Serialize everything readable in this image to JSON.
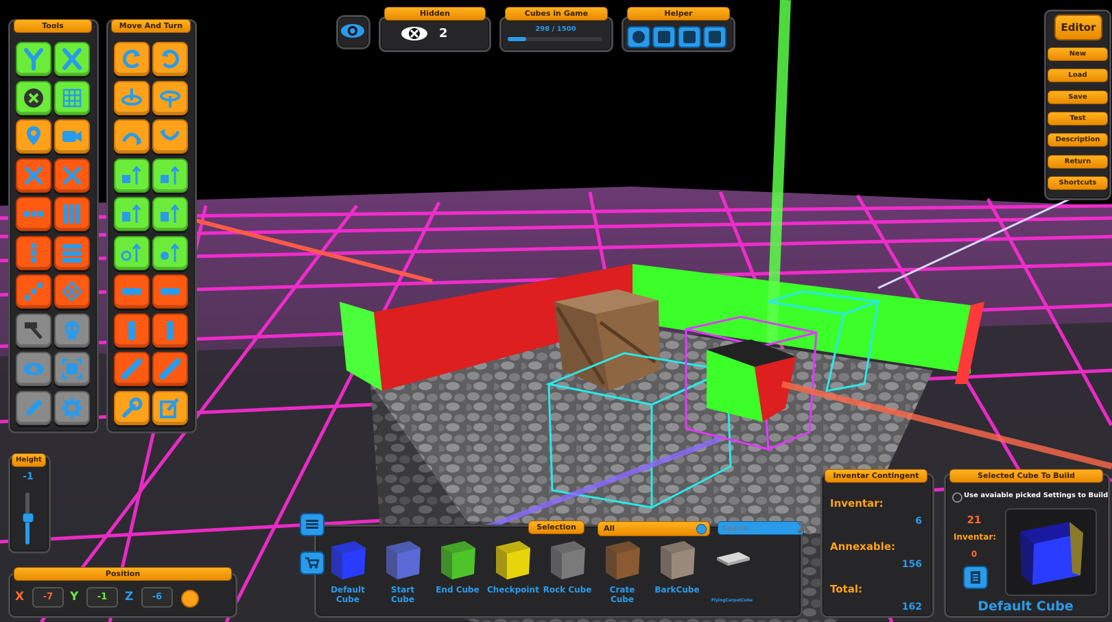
{
  "tools_panel": {
    "title": "Tools",
    "tools": [
      {
        "icon": "y-axis-icon",
        "color": "green"
      },
      {
        "icon": "x-axis-icon",
        "color": "green"
      },
      {
        "icon": "circle-x-icon",
        "color": "green"
      },
      {
        "icon": "grid-icon",
        "color": "green"
      },
      {
        "icon": "map-pin-icon",
        "color": "orange"
      },
      {
        "icon": "camera-icon",
        "color": "orange"
      },
      {
        "icon": "collapse-icon",
        "color": "red"
      },
      {
        "icon": "expand-icon",
        "color": "red"
      },
      {
        "icon": "row-dots-icon",
        "color": "red"
      },
      {
        "icon": "column-dots-icon",
        "color": "red"
      },
      {
        "icon": "vertical-dots-icon",
        "color": "red"
      },
      {
        "icon": "list-icon",
        "color": "red"
      },
      {
        "icon": "diagonal-dots-icon",
        "color": "red"
      },
      {
        "icon": "diagonal-grid-icon",
        "color": "red"
      },
      {
        "icon": "hammer-icon",
        "color": "gray"
      },
      {
        "icon": "skull-icon",
        "color": "gray"
      },
      {
        "icon": "hidden-eye-icon",
        "color": "gray"
      },
      {
        "icon": "frame-icon",
        "color": "gray"
      },
      {
        "icon": "pencil-icon",
        "color": "gray"
      },
      {
        "icon": "gear-icon",
        "color": "gray"
      }
    ]
  },
  "move_panel": {
    "title": "Move And Turn",
    "tools": [
      {
        "icon": "rotate-left-icon",
        "color": "orange"
      },
      {
        "icon": "rotate-right-icon",
        "color": "orange"
      },
      {
        "icon": "turn-down-icon",
        "color": "orange"
      },
      {
        "icon": "turn-up-icon",
        "color": "orange"
      },
      {
        "icon": "flip-left-icon",
        "color": "orange"
      },
      {
        "icon": "flip-right-icon",
        "color": "orange"
      },
      {
        "icon": "move-up-triangle-icon",
        "color": "green"
      },
      {
        "icon": "move-up-square-icon",
        "color": "green"
      },
      {
        "icon": "move-left-icon",
        "color": "green"
      },
      {
        "icon": "move-right-icon",
        "color": "green"
      },
      {
        "icon": "move-circle-icon",
        "color": "green"
      },
      {
        "icon": "move-target-icon",
        "color": "green"
      },
      {
        "icon": "bar-horizontal-icon",
        "color": "red"
      },
      {
        "icon": "bar-horizontal-icon",
        "color": "red"
      },
      {
        "icon": "bar-vertical-icon",
        "color": "red"
      },
      {
        "icon": "bar-vertical-icon",
        "color": "red"
      },
      {
        "icon": "bar-diagonal-icon",
        "color": "red"
      },
      {
        "icon": "bar-diagonal-icon",
        "color": "red"
      },
      {
        "icon": "wrench-icon",
        "color": "orange"
      },
      {
        "icon": "edit-icon",
        "color": "orange"
      }
    ]
  },
  "height_panel": {
    "title": "Height",
    "value": "-1",
    "slider_fraction": 0.5
  },
  "position_panel": {
    "title": "Position",
    "x_label": "X",
    "x": "-7",
    "y_label": "Y",
    "y": "-1",
    "z_label": "Z",
    "z": "-6"
  },
  "top_bar": {
    "hidden": {
      "title": "Hidden",
      "count": "2"
    },
    "cubes_in_game": {
      "title": "Cubes in Game",
      "text": "298 / 1500",
      "fraction": 0.199
    },
    "helper": {
      "title": "Helper",
      "icons": [
        "center-icon",
        "up-arrow-icon",
        "frame-select-icon",
        "eraser-icon"
      ]
    }
  },
  "editor_menu": {
    "title": "Editor",
    "items": [
      "New",
      "Load",
      "Save",
      "Test",
      "Description",
      "Return",
      "Shortcuts"
    ]
  },
  "selection_bar": {
    "title": "Selection",
    "filter": "All",
    "search_placeholder": "Search...",
    "cubes": [
      {
        "name_line1": "Default",
        "name_line2": "Cube",
        "color": "#2a3cff"
      },
      {
        "name_line1": "Start",
        "name_line2": "Cube",
        "color": "#5a6ad6"
      },
      {
        "name_line1": "End Cube",
        "name_line2": "",
        "color": "#4ec42a"
      },
      {
        "name_line1": "Checkpoint",
        "name_line2": "",
        "color": "#e8d40a"
      },
      {
        "name_line1": "Rock Cube",
        "name_line2": "",
        "color": "#7a7a7a"
      },
      {
        "name_line1": "Crate",
        "name_line2": "Cube",
        "color": "#8a5a32"
      },
      {
        "name_line1": "BarkCube",
        "name_line2": "",
        "color": "#9a8a7a"
      },
      {
        "name_line1": "FlyingCarpetCube",
        "name_line2": "",
        "color": "#d8d8d8"
      }
    ]
  },
  "inventar_contingent": {
    "title": "Inventar Contingent",
    "inventar_label": "Inventar:",
    "inventar": "6",
    "annexable_label": "Annexable:",
    "annexable": "156",
    "total_label": "Total:",
    "total": "162"
  },
  "selected_cube": {
    "title": "Selected Cube To Build",
    "option": "Use avaiable picked Settings to Build",
    "count": "21",
    "inventar_label": "Inventar:",
    "inventar": "0",
    "name": "Default Cube"
  },
  "colors": {
    "accent": "#ffa21a",
    "blue": "#2a9bea",
    "grid": "#ff2bd6",
    "panel": "#262628"
  }
}
